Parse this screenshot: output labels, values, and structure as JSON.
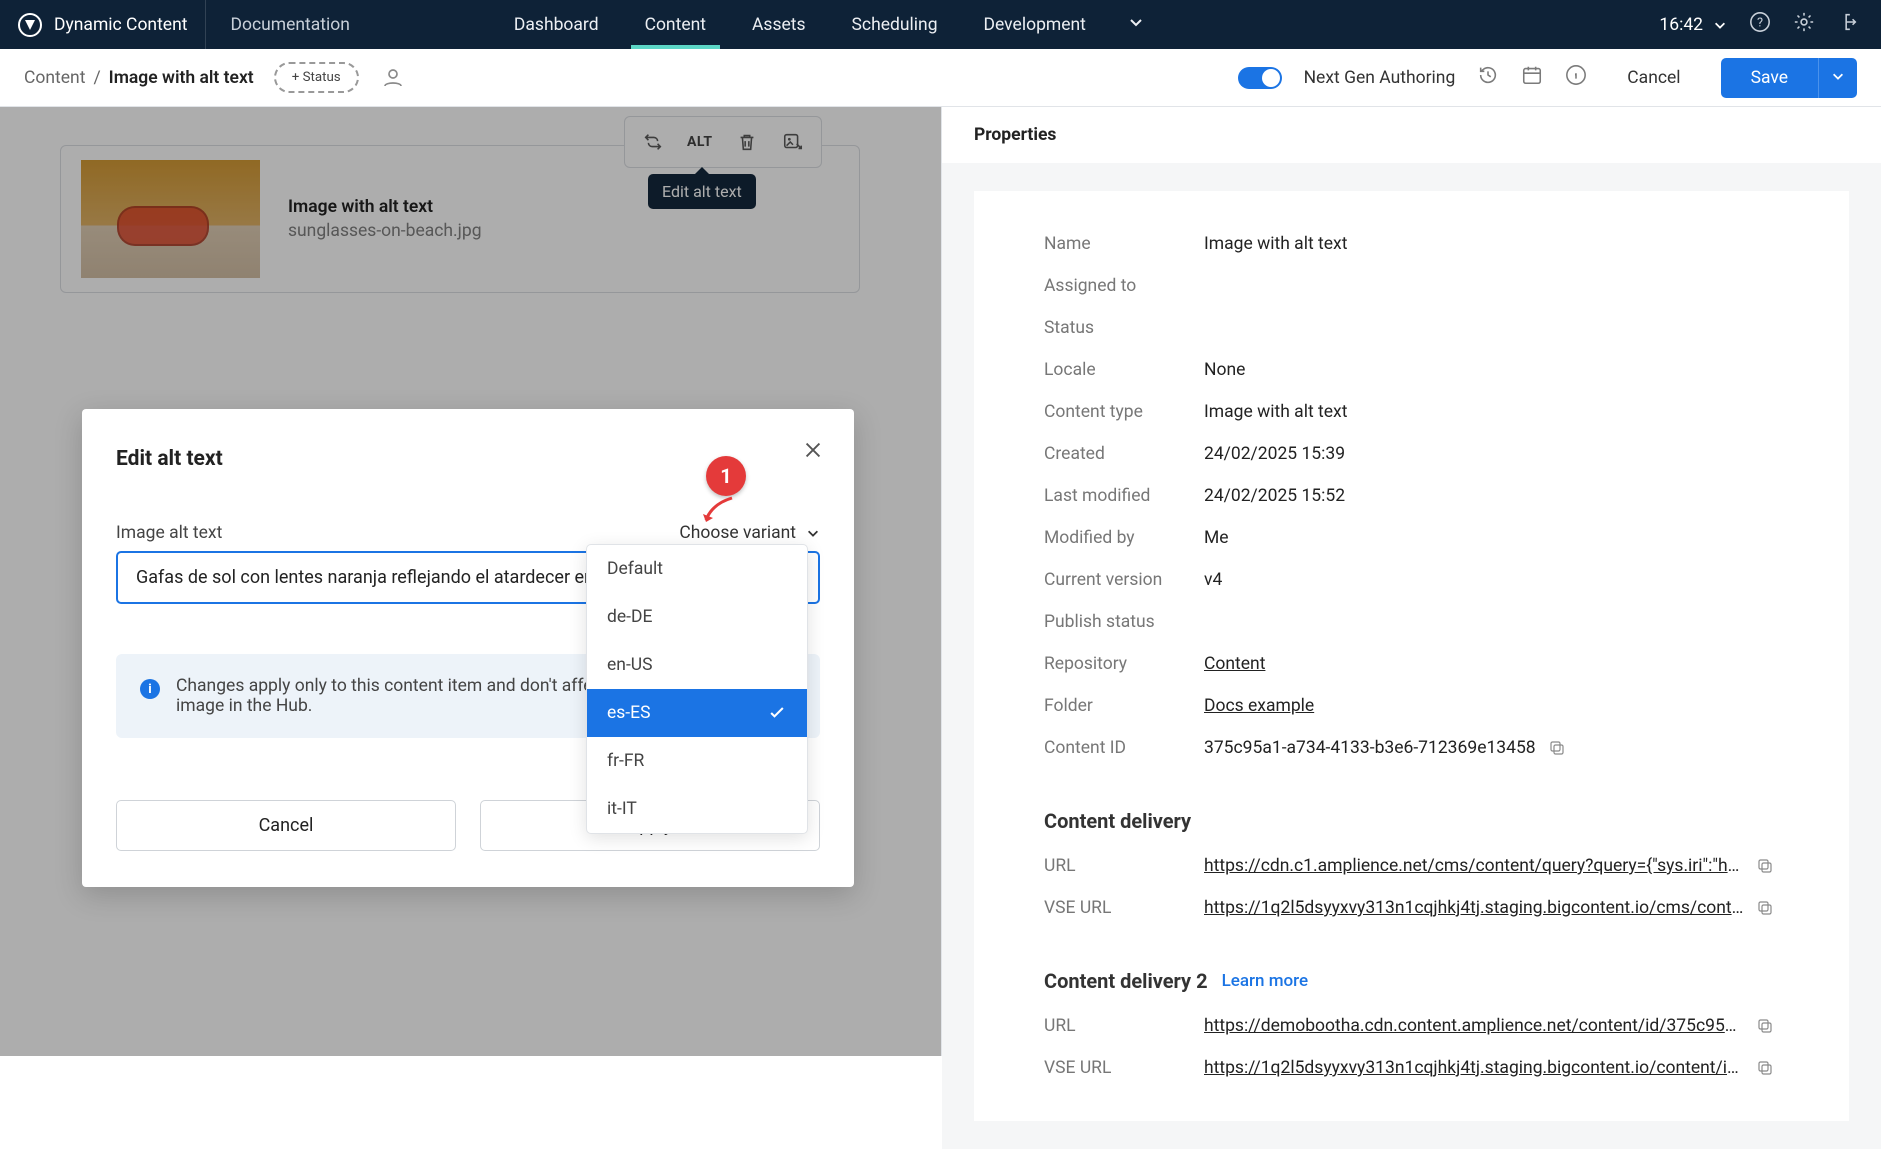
{
  "topbar": {
    "brand": "Dynamic Content",
    "subtitle": "Documentation",
    "nav": {
      "dashboard": "Dashboard",
      "content": "Content",
      "assets": "Assets",
      "scheduling": "Scheduling",
      "development": "Development"
    },
    "clock": "16:42"
  },
  "subbar": {
    "crumb_root": "Content",
    "crumb_slash": "/",
    "crumb_current": "Image with alt text",
    "status_add": "+ Status",
    "toggle_label": "Next Gen Authoring",
    "cancel": "Cancel",
    "save": "Save"
  },
  "card": {
    "title": "Image with alt text",
    "filename": "sunglasses-on-beach.jpg"
  },
  "mini_toolbar": {
    "alt": "ALT"
  },
  "tooltip": "Edit alt text",
  "modal": {
    "title": "Edit alt text",
    "image_alt_label": "Image alt text",
    "variant_label": "Choose variant",
    "input_value": "Gafas de sol con lentes naranja reflejando el atardecer en",
    "info": "Changes apply only to this content item and don't affect other uses of this image in the Hub.",
    "cancel": "Cancel",
    "apply": "Apply"
  },
  "dropdown": {
    "options": {
      "0": "Default",
      "1": "de-DE",
      "2": "en-US",
      "3": "es-ES",
      "4": "fr-FR",
      "5": "it-IT"
    },
    "selected_index": 3
  },
  "badge": "1",
  "properties": {
    "header": "Properties",
    "fields": {
      "name_k": "Name",
      "name_v": "Image with alt text",
      "assigned_k": "Assigned to",
      "assigned_v": "",
      "status_k": "Status",
      "status_v": "",
      "locale_k": "Locale",
      "locale_v": "None",
      "ctype_k": "Content type",
      "ctype_v": "Image with alt text",
      "created_k": "Created",
      "created_v": "24/02/2025 15:39",
      "modified_k": "Last modified",
      "modified_v": "24/02/2025 15:52",
      "modby_k": "Modified by",
      "modby_v": "Me",
      "ver_k": "Current version",
      "ver_v": "v4",
      "pubstat_k": "Publish status",
      "pubstat_v": "",
      "repo_k": "Repository",
      "repo_v": "Content",
      "folder_k": "Folder",
      "folder_v": "Docs example",
      "cid_k": "Content ID",
      "cid_v": "375c95a1-a734-4133-b3e6-712369e13458"
    },
    "delivery1_h": "Content delivery",
    "delivery1": {
      "url_k": "URL",
      "url_v": "https://cdn.c1.amplience.net/cms/content/query?query={\"sys.iri\":\"http://c…",
      "vse_k": "VSE URL",
      "vse_v": "https://1q2l5dsyyxvy313n1cqjhkj4tj.staging.bigcontent.io/cms/content/q…"
    },
    "delivery2_h": "Content delivery 2",
    "delivery2_learn": "Learn more",
    "delivery2": {
      "url_k": "URL",
      "url_v": "https://demobootha.cdn.content.amplience.net/content/id/375c95a1-a7…",
      "vse_k": "VSE URL",
      "vse_v": "https://1q2l5dsyyxvy313n1cqjhkj4tj.staging.bigcontent.io/content/id/375…"
    }
  },
  "icons": {
    "swap": "swap-icon",
    "trash": "trash-icon",
    "image_alt": "image-edit-icon"
  }
}
